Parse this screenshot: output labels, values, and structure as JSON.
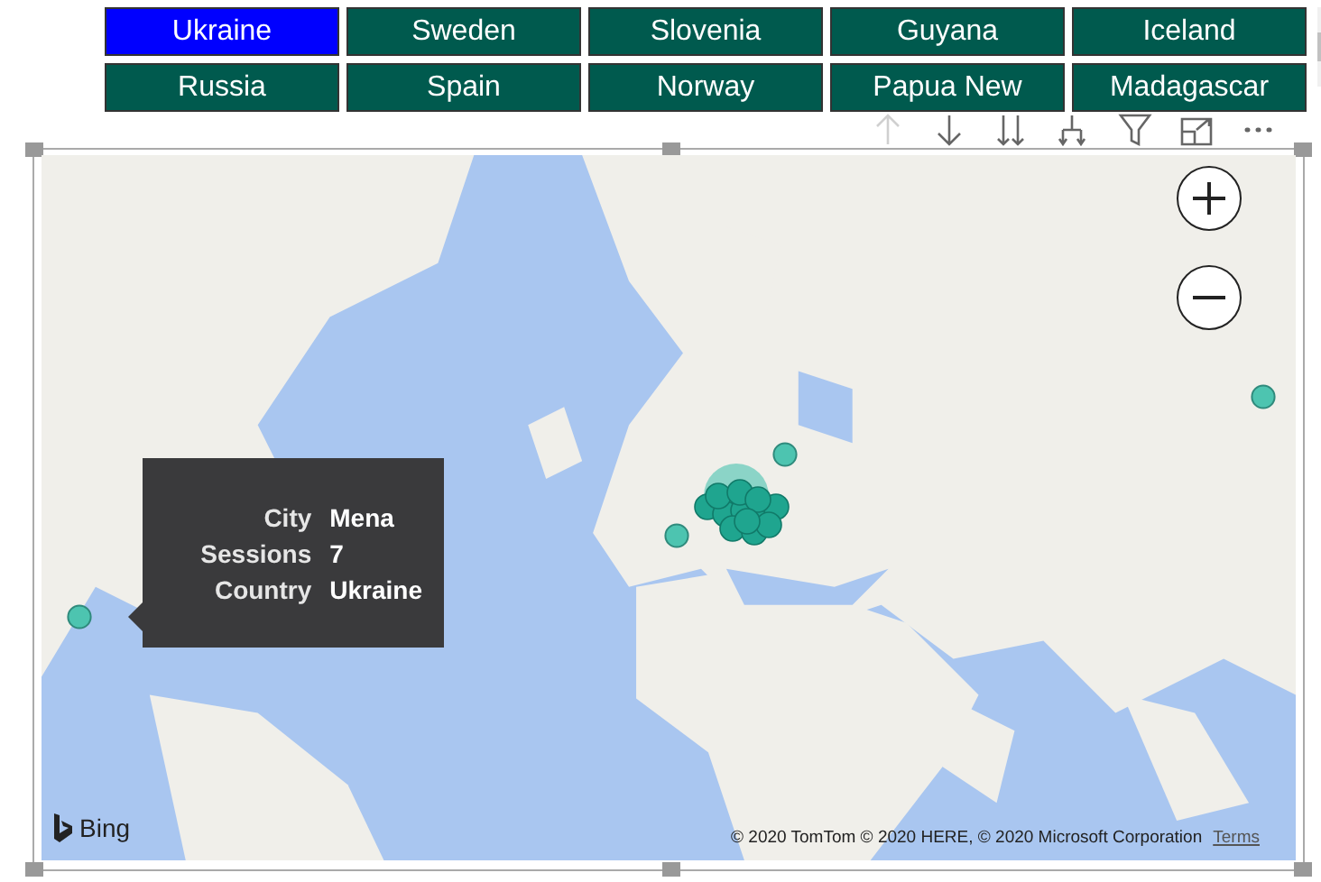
{
  "slicer": {
    "items": [
      {
        "label": "Ukraine",
        "selected": true
      },
      {
        "label": "Sweden",
        "selected": false
      },
      {
        "label": "Slovenia",
        "selected": false
      },
      {
        "label": "Guyana",
        "selected": false
      },
      {
        "label": "Iceland",
        "selected": false
      },
      {
        "label": "Russia",
        "selected": false
      },
      {
        "label": "Spain",
        "selected": false
      },
      {
        "label": "Norway",
        "selected": false
      },
      {
        "label": "Papua New",
        "selected": false
      },
      {
        "label": "Madagascar",
        "selected": false
      }
    ]
  },
  "visual_header": {
    "buttons": [
      {
        "kind": "up",
        "disabled": true
      },
      {
        "kind": "down",
        "disabled": false
      },
      {
        "kind": "expand",
        "disabled": false
      },
      {
        "kind": "drill",
        "disabled": false
      },
      {
        "kind": "filter",
        "disabled": false
      },
      {
        "kind": "focus",
        "disabled": false
      },
      {
        "kind": "more",
        "disabled": false
      }
    ]
  },
  "map": {
    "kind": "picture",
    "tooltip": {
      "rows": [
        {
          "label": "City",
          "value": "Mena"
        },
        {
          "label": "Sessions",
          "value": "7"
        },
        {
          "label": "Country",
          "value": "Ukraine"
        }
      ]
    },
    "logo": "Bing",
    "attribution": "© 2020 TomTom © 2020 HERE, © 2020 Microsoft Corporation",
    "terms_link": "Terms"
  }
}
